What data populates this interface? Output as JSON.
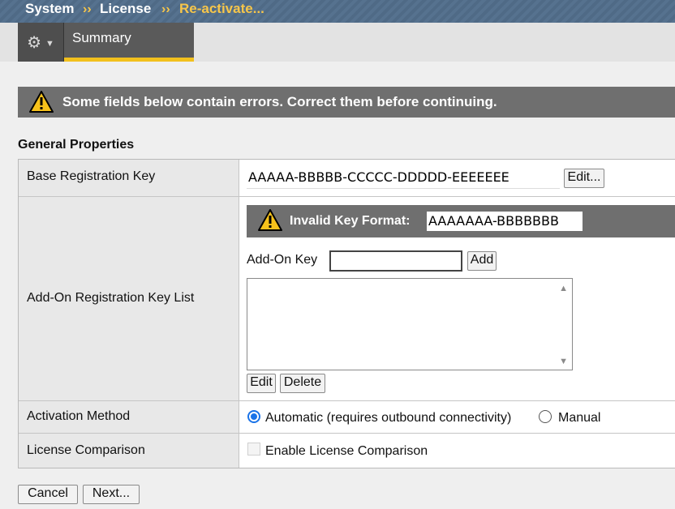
{
  "breadcrumb": {
    "system": "System",
    "license": "License",
    "current": "Re-activate...",
    "separator": "››"
  },
  "tabs": {
    "summary": "Summary"
  },
  "error_banner": {
    "message": "Some fields below contain errors. Correct them before continuing."
  },
  "section_title": "General Properties",
  "properties": {
    "base_key": {
      "label": "Base Registration Key",
      "value": "AAAAA-BBBBB-CCCCC-DDDDD-EEEEEEE",
      "edit_button": "Edit..."
    },
    "addon": {
      "label": "Add-On Registration Key List",
      "invalid_title": "Invalid Key Format:",
      "invalid_value": "AAAAAAA-BBBBBBB",
      "addon_key_label": "Add-On Key",
      "addon_key_value": "",
      "add_button": "Add",
      "list_items": [],
      "edit_button": "Edit",
      "delete_button": "Delete"
    },
    "activation": {
      "label": "Activation Method",
      "automatic": "Automatic (requires outbound connectivity)",
      "manual": "Manual",
      "selected": "automatic"
    },
    "comparison": {
      "label": "License Comparison",
      "checkbox_label": "Enable License Comparison",
      "checked": false,
      "disabled": true
    }
  },
  "actions": {
    "cancel": "Cancel",
    "next": "Next..."
  },
  "colors": {
    "breadcrumb_highlight": "#f7c64a",
    "tab_underline": "#f2c01d",
    "banner_bg": "#6f6f6f",
    "radio_selected": "#1a73e8"
  }
}
